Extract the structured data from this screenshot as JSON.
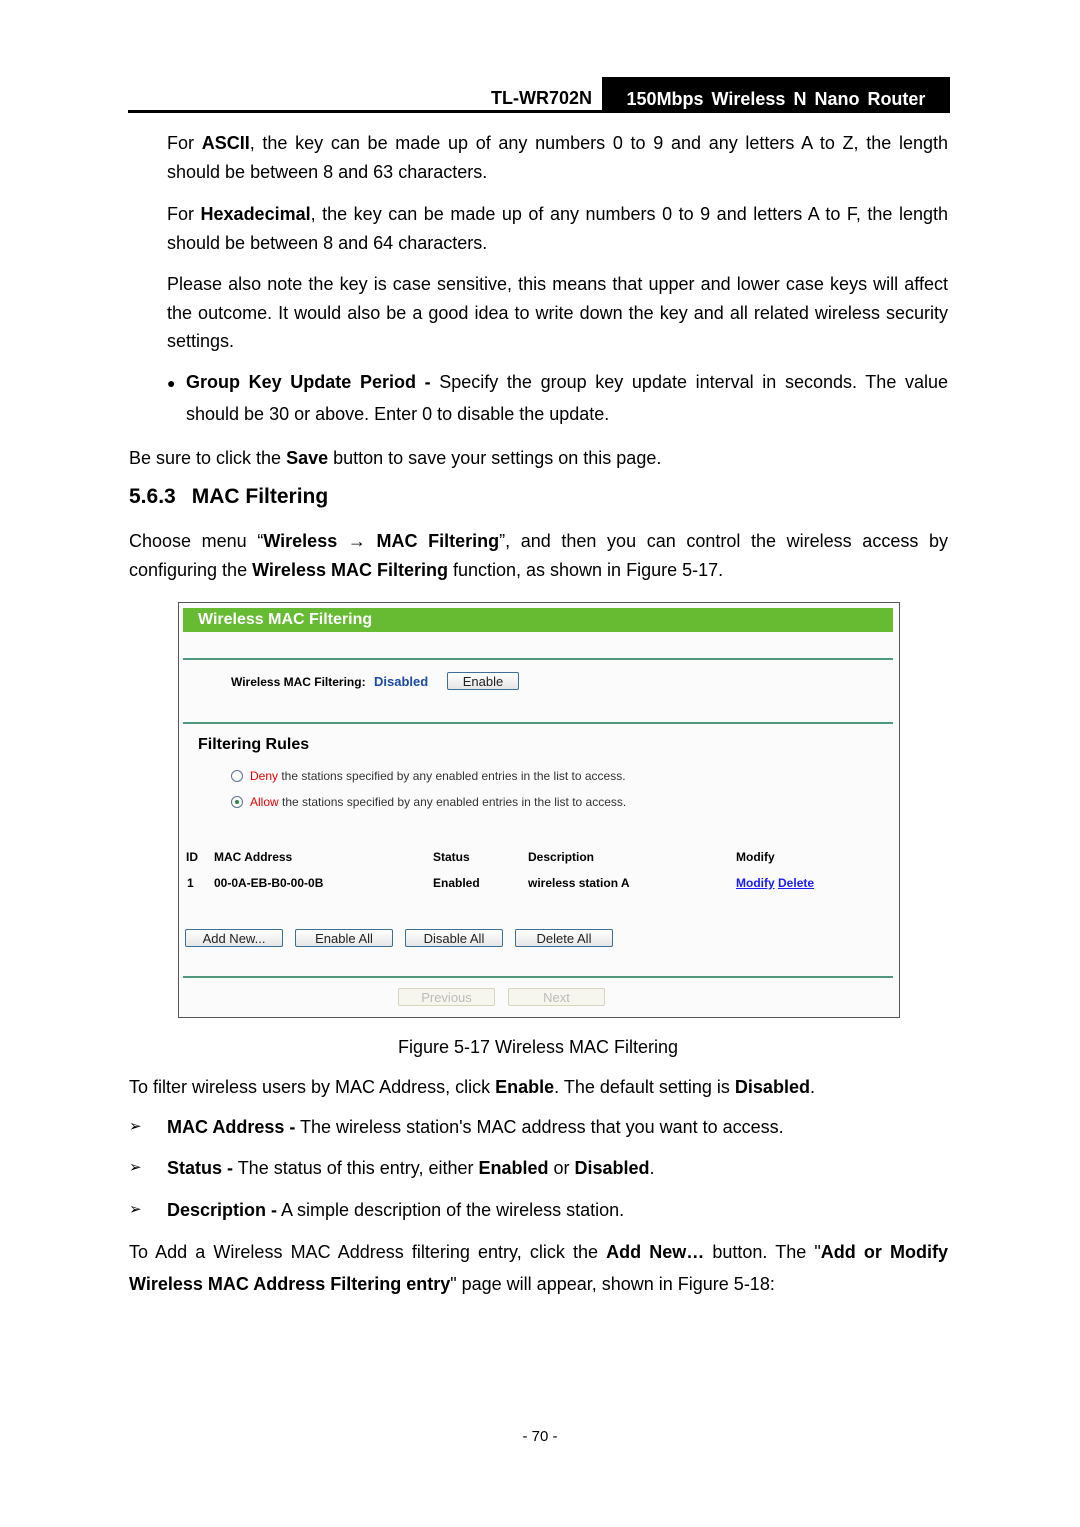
{
  "header": {
    "model": "TL-WR702N",
    "product": "150Mbps Wireless N Nano Router"
  },
  "body": {
    "ascii": {
      "a": "For ",
      "b": "ASCII",
      "c": ", the key can be made up of any numbers 0 to 9 and any letters A to Z, the length should be between 8 and 63 characters."
    },
    "hex": {
      "a": "For ",
      "b": "Hexadecimal",
      "c": ", the key can be made up of any numbers 0 to 9 and letters A to F, the length should be between 8 and 64 characters."
    },
    "note": "Please also note the key is case sensitive, this means that upper and lower case keys will affect the outcome. It would also be a good idea to write down the key and all related wireless security settings.",
    "group": {
      "b": "Group Key Update Period -",
      "c": " Specify the group key update interval in seconds. The value should be 30 or above. Enter 0 to disable the update."
    },
    "save": {
      "a": "Be sure to click the ",
      "b": "Save",
      "c": " button to save your settings on this page."
    },
    "section": {
      "num": "5.6.3",
      "title": "MAC Filtering"
    },
    "choose": {
      "a": "Choose menu “",
      "b": "Wireless",
      "arrow": " → ",
      "c": "MAC Filtering",
      "d": "”, and then you can control the wireless access by configuring the ",
      "e": "Wireless MAC Filtering",
      "f": " function, as shown in Figure 5-17."
    },
    "caption": "Figure 5-17 Wireless MAC Filtering",
    "filter": {
      "a": "To filter wireless users by MAC Address, click ",
      "b": "Enable",
      "c": ". The default setting is ",
      "d": "Disabled",
      "e": "."
    },
    "items": [
      {
        "b": "MAC Address -",
        "c": " The wireless station's MAC address that you want to access."
      },
      {
        "b": "Status -",
        "c": " The status of this entry, either ",
        "d": "Enabled",
        "e": " or ",
        "f": "Disabled",
        "g": "."
      },
      {
        "b": "Description -",
        "c": " A simple description of the wireless station."
      }
    ],
    "add": {
      "a": "To Add a Wireless MAC Address filtering entry, click the ",
      "b": "Add New…",
      "c": " button. The \"",
      "d": "Add or Modify Wireless MAC Address Filtering entry",
      "e": "\" page will appear, shown in Figure 5-18:"
    },
    "page_number": "- 70 -"
  },
  "screenshot": {
    "title": "Wireless MAC Filtering",
    "status_label": "Wireless MAC Filtering:",
    "status_value": "Disabled",
    "enable_button": "Enable",
    "rules_title": "Filtering Rules",
    "deny": {
      "word": "Deny",
      "rest": " the stations specified by any enabled entries in the list to access.",
      "selected": false
    },
    "allow": {
      "word": "Allow",
      "rest": " the stations specified by any enabled entries in the list to access.",
      "selected": true
    },
    "columns": [
      "ID",
      "MAC Address",
      "Status",
      "Description",
      "Modify"
    ],
    "rows": [
      {
        "id": "1",
        "mac": "00-0A-EB-B0-00-0B",
        "status": "Enabled",
        "description": "wireless station A",
        "modify": "Modify",
        "delete": "Delete"
      }
    ],
    "buttons": [
      "Add New...",
      "Enable All",
      "Disable All",
      "Delete All"
    ],
    "prev": "Previous",
    "next": "Next",
    "colors": {
      "title_bar": "#66bb33",
      "rule": "#4f9a7c",
      "status": "#1a4aa8",
      "link": "#1a1aff",
      "option": "#ee0000"
    }
  }
}
